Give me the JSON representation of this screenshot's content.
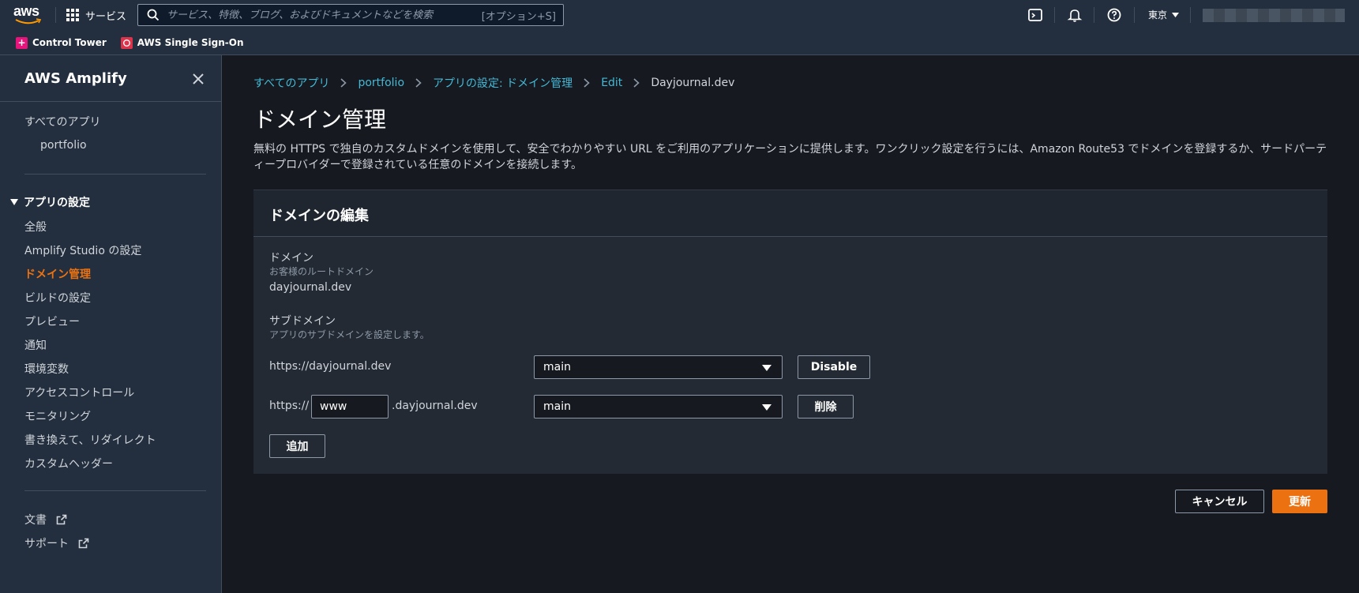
{
  "topbar": {
    "logo_text": "aws",
    "services_label": "サービス",
    "search_placeholder": "サービス、特徴、ブログ、およびドキュメントなどを検索",
    "search_shortcut": "[オプション+S]",
    "region": "東京"
  },
  "bookmarks": [
    {
      "label": "Control Tower",
      "color": "#e7157b"
    },
    {
      "label": "AWS Single Sign-On",
      "color": "#dd344c"
    }
  ],
  "sidebar": {
    "title": "AWS Amplify",
    "all_apps": "すべてのアプリ",
    "app_name": "portfolio",
    "section_title": "アプリの設定",
    "items": [
      "全般",
      "Amplify Studio の設定",
      "ドメイン管理",
      "ビルドの設定",
      "プレビュー",
      "通知",
      "環境変数",
      "アクセスコントロール",
      "モニタリング",
      "書き換えて、リダイレクト",
      "カスタムヘッダー"
    ],
    "active_item": "ドメイン管理",
    "footer_links": [
      "文書",
      "サポート"
    ]
  },
  "breadcrumb": [
    "すべてのアプリ",
    "portfolio",
    "アプリの設定: ドメイン管理",
    "Edit",
    "Dayjournal.dev"
  ],
  "page": {
    "title": "ドメイン管理",
    "description": "無料の HTTPS で独自のカスタムドメインを使用して、安全でわかりやすい URL をご利用のアプリケーションに提供します。ワンクリック設定を行うには、Amazon Route53 でドメインを登録するか、サードパーティープロバイダーで登録されている任意のドメインを接続します。"
  },
  "panel": {
    "title": "ドメインの編集",
    "domain_label": "ドメイン",
    "domain_sublabel": "お客様のルートドメイン",
    "domain_value": "dayjournal.dev",
    "subdomain_label": "サブドメイン",
    "subdomain_sublabel": "アプリのサブドメインを設定します。",
    "rows": [
      {
        "url": "https://dayjournal.dev",
        "branch": "main",
        "button": "Disable"
      },
      {
        "prefix": "https://",
        "input_value": "www",
        "suffix": ".dayjournal.dev",
        "branch": "main",
        "button": "削除"
      }
    ],
    "add_button": "追加"
  },
  "actions": {
    "cancel": "キャンセル",
    "update": "更新"
  },
  "colors": {
    "accent": "#ec7211",
    "link": "#44b9d6",
    "nav_bg": "#232f3e"
  }
}
